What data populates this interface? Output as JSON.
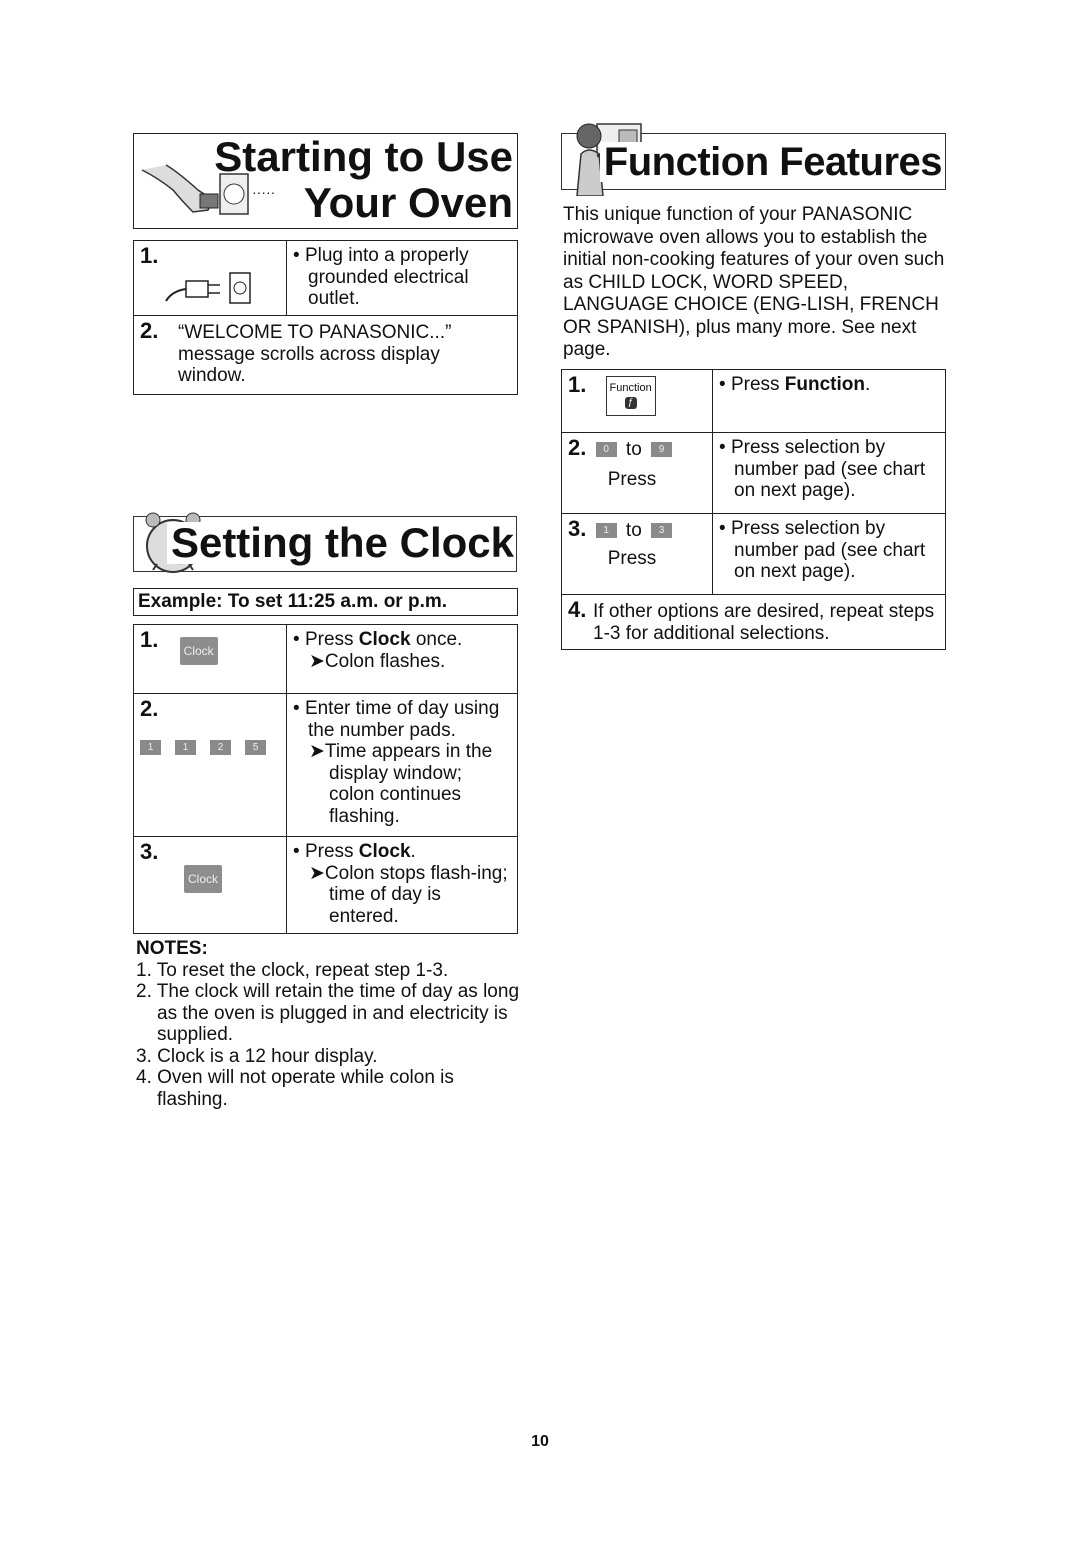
{
  "left": {
    "section1": {
      "title_line1": "Starting to Use",
      "title_line2": "Your Oven",
      "dots": "·····",
      "steps": [
        {
          "num": "1.",
          "text": "Plug into a properly grounded electrical outlet."
        },
        {
          "num": "2.",
          "text": "“WELCOME TO PANASONIC...” message scrolls across display window."
        }
      ]
    },
    "section2": {
      "title": "Setting the Clock",
      "example": "Example: To set 11:25 a.m. or p.m.",
      "steps": [
        {
          "num": "1.",
          "button": "Clock",
          "pre": "Press ",
          "bold": "Clock",
          "post": " once.",
          "sub": "Colon flashes."
        },
        {
          "num": "2.",
          "pads": [
            "1",
            "1",
            "2",
            "5"
          ],
          "text": "Enter time of day using the number pads.",
          "sub": "Time appears in the display window; colon continues flashing."
        },
        {
          "num": "3.",
          "button": "Clock",
          "pre": "Press ",
          "bold": "Clock",
          "post": ".",
          "sub": "Colon stops flash-ing; time of day is entered."
        }
      ],
      "notes_title": "NOTES:",
      "notes": [
        "1. To reset the clock, repeat step 1-3.",
        "2. The clock will retain the time of day as long as the oven is plugged in and electricity is supplied.",
        "3. Clock is a 12 hour display.",
        "4. Oven will not operate while colon is flashing."
      ]
    }
  },
  "right": {
    "title": "Function Features",
    "intro": "This unique function of your PANASONIC microwave oven allows you to establish the initial non-cooking features of your oven such as CHILD LOCK, WORD SPEED, LANGUAGE CHOICE (ENG-LISH, FRENCH OR SPANISH), plus many more. See next page.",
    "steps": [
      {
        "num": "1.",
        "button": "Function",
        "pre": "Press ",
        "bold": "Function",
        "post": "."
      },
      {
        "num": "2.",
        "from": "0",
        "to_word": "to",
        "to": "9",
        "press": "Press",
        "text": "Press selection by number pad (see chart on next page)."
      },
      {
        "num": "3.",
        "from": "1",
        "to_word": "to",
        "to": "3",
        "press": "Press",
        "text": "Press selection by number pad (see chart on next page)."
      },
      {
        "num": "4.",
        "text": "If other options are desired, repeat steps 1-3 for additional selections."
      }
    ]
  },
  "bullet": "•",
  "arrow": "➤",
  "page_number": "10"
}
